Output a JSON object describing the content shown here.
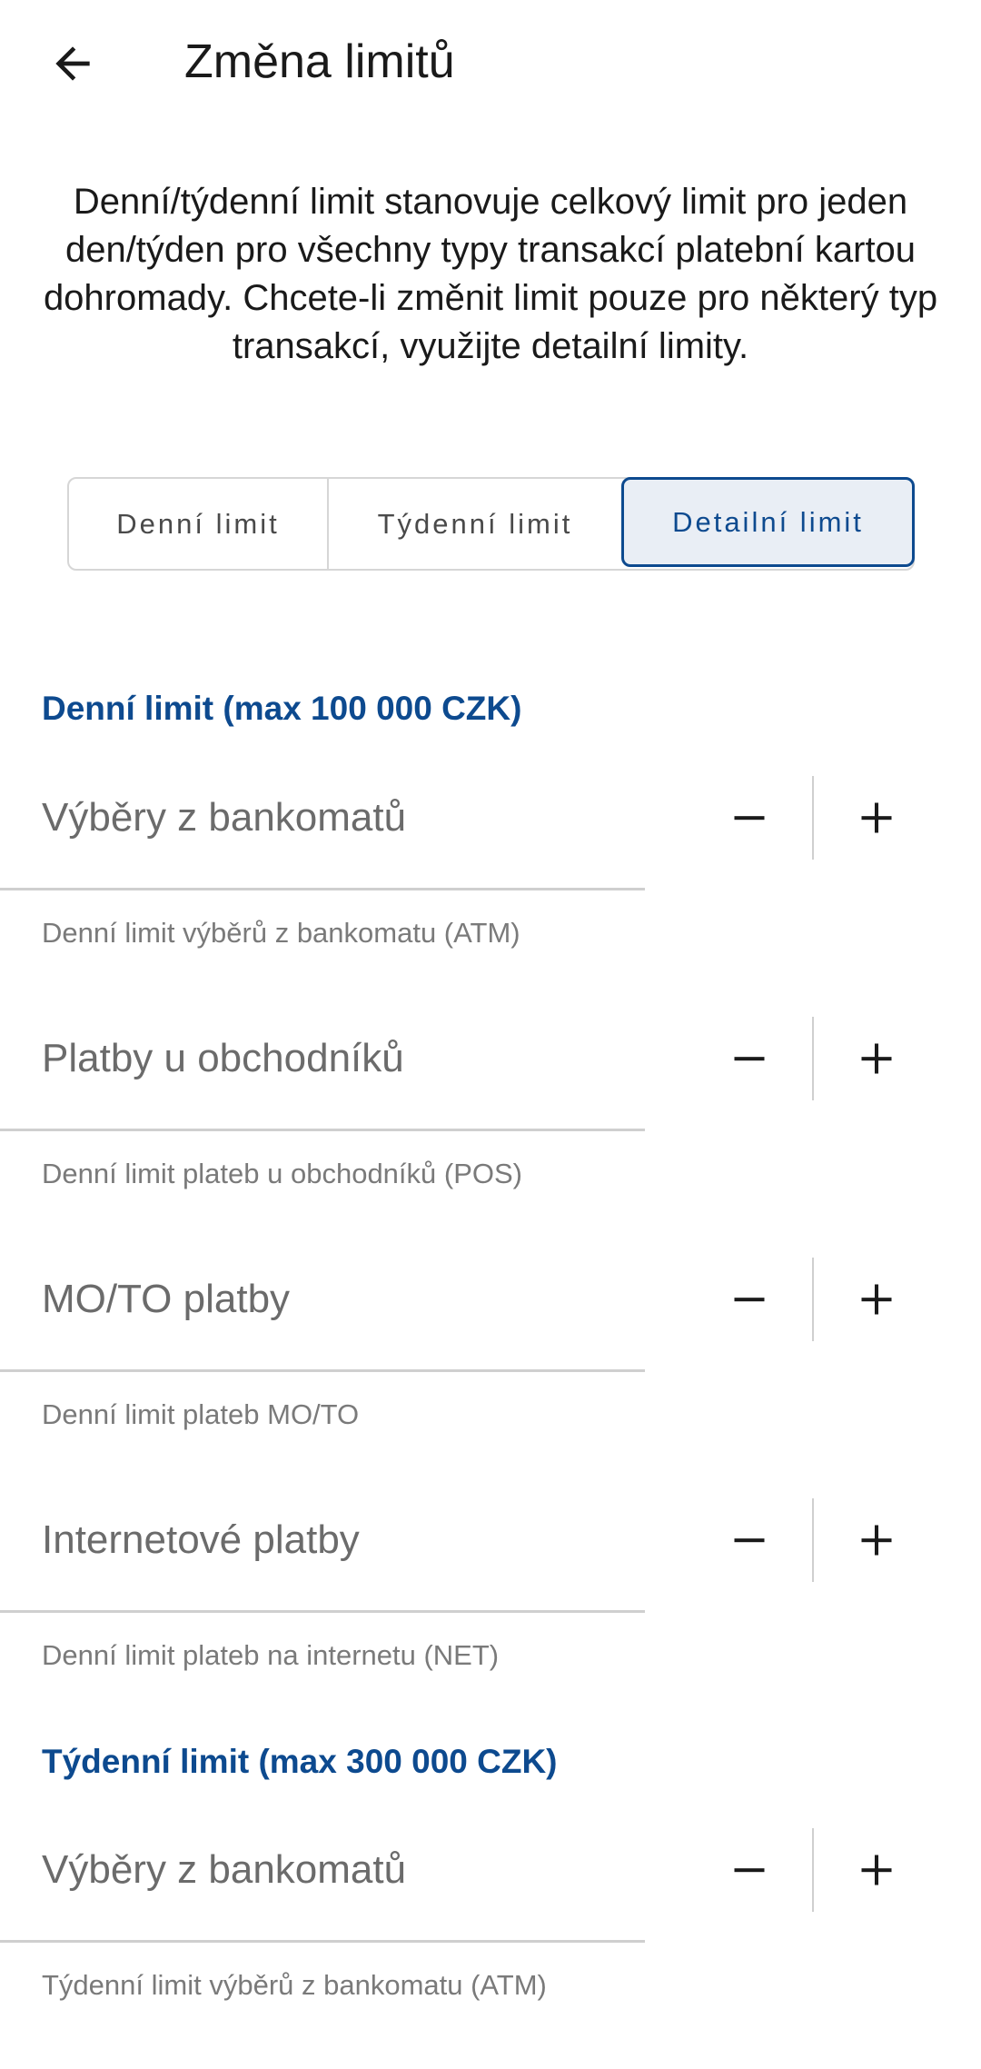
{
  "header": {
    "title": "Změna limitů",
    "back_icon": "arrow-left-icon"
  },
  "intro": "Denní/týdenní limit stanovuje celkový limit pro jeden den/týden pro všechny typy transakcí platební kartou dohromady. Chcete-li změnit limit pouze pro některý typ transakcí, využijte detailní limity.",
  "tabs": [
    {
      "label": "Denní limit",
      "selected": false
    },
    {
      "label": "Týdenní limit",
      "selected": false
    },
    {
      "label": "Detailní limit",
      "selected": true
    }
  ],
  "sections": [
    {
      "heading": "Denní limit (max 100 000 CZK)",
      "items": [
        {
          "label": "Výběry z bankomatů",
          "helper": "Denní limit výběrů z bankomatu (ATM)"
        },
        {
          "label": "Platby u obchodníků",
          "helper": "Denní limit plateb u obchodníků (POS)"
        },
        {
          "label": "MO/TO platby",
          "helper": "Denní limit plateb MO/TO"
        },
        {
          "label": "Internetové platby",
          "helper": "Denní limit plateb na internetu (NET)"
        }
      ]
    },
    {
      "heading": "Týdenní limit (max 300 000 CZK)",
      "items": [
        {
          "label": "Výběry z bankomatů",
          "helper": "Týdenní limit výběrů z bankomatu (ATM)"
        }
      ]
    }
  ],
  "colors": {
    "accent": "#0d4a8f",
    "selected_tab_bg": "#e9eef5",
    "label_gray": "#6b6b6b",
    "divider": "#cfcfcf"
  }
}
